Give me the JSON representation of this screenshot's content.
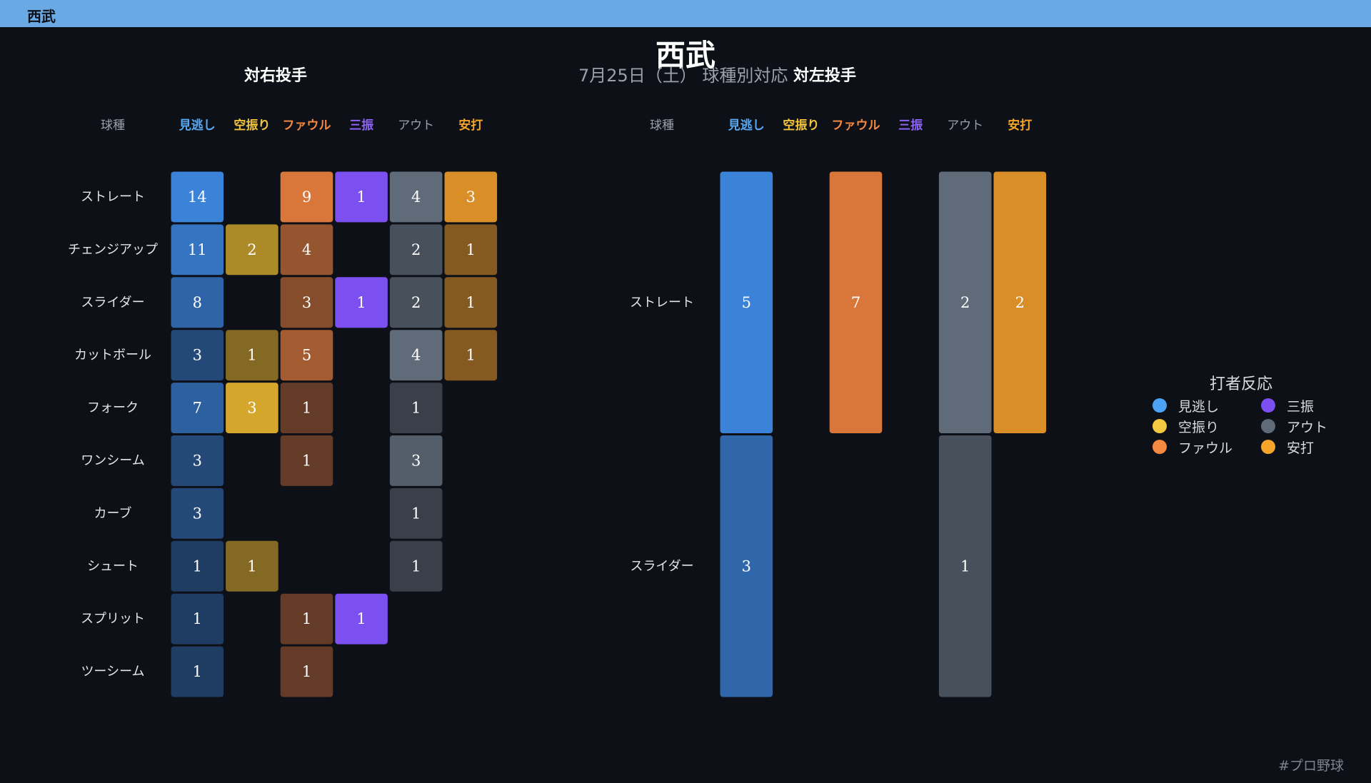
{
  "header": {
    "title": "西武"
  },
  "main_title": "西武",
  "subtitle": "7月25日（土） 球種別対応",
  "hashtag": "#プロ野球",
  "colors": {
    "background": "#0d1017",
    "header_bar": "#6aaae4",
    "見逃し": "#4da3f5",
    "空振り": "#f5c842",
    "ファウル": "#f58942",
    "三振": "#7b4ff0",
    "アウト": "#5f6b78",
    "安打": "#f5a52a"
  },
  "legend": {
    "title": "打者反応",
    "items": [
      {
        "label": "見逃し",
        "color": "#4da3f5"
      },
      {
        "label": "三振",
        "color": "#7b4ff0"
      },
      {
        "label": "空振り",
        "color": "#f5c842"
      },
      {
        "label": "アウト",
        "color": "#5f6b78"
      },
      {
        "label": "ファウル",
        "color": "#f58942"
      },
      {
        "label": "安打",
        "color": "#f5a52a"
      }
    ]
  },
  "chart_data": [
    {
      "type": "heatmap",
      "title": "対右投手",
      "row_header": "球種",
      "columns": [
        "見逃し",
        "空振り",
        "ファウル",
        "三振",
        "アウト",
        "安打"
      ],
      "rows": [
        "ストレート",
        "チェンジアップ",
        "スライダー",
        "カットボール",
        "フォーク",
        "ワンシーム",
        "カーブ",
        "シュート",
        "スプリット",
        "ツーシーム"
      ],
      "values": [
        [
          14,
          null,
          9,
          1,
          4,
          3
        ],
        [
          11,
          2,
          4,
          null,
          2,
          1
        ],
        [
          8,
          null,
          3,
          1,
          2,
          1
        ],
        [
          3,
          1,
          5,
          null,
          4,
          1
        ],
        [
          7,
          3,
          1,
          null,
          1,
          null
        ],
        [
          3,
          null,
          1,
          null,
          3,
          null
        ],
        [
          3,
          null,
          null,
          null,
          1,
          null
        ],
        [
          1,
          1,
          null,
          null,
          1,
          null
        ],
        [
          1,
          null,
          1,
          1,
          null,
          null
        ],
        [
          1,
          null,
          1,
          null,
          null,
          null
        ]
      ]
    },
    {
      "type": "heatmap",
      "title": "対左投手",
      "row_header": "球種",
      "columns": [
        "見逃し",
        "空振り",
        "ファウル",
        "三振",
        "アウト",
        "安打"
      ],
      "rows": [
        "ストレート",
        "スライダー"
      ],
      "values": [
        [
          5,
          null,
          7,
          null,
          2,
          2
        ],
        [
          3,
          null,
          null,
          null,
          1,
          null
        ]
      ]
    }
  ]
}
